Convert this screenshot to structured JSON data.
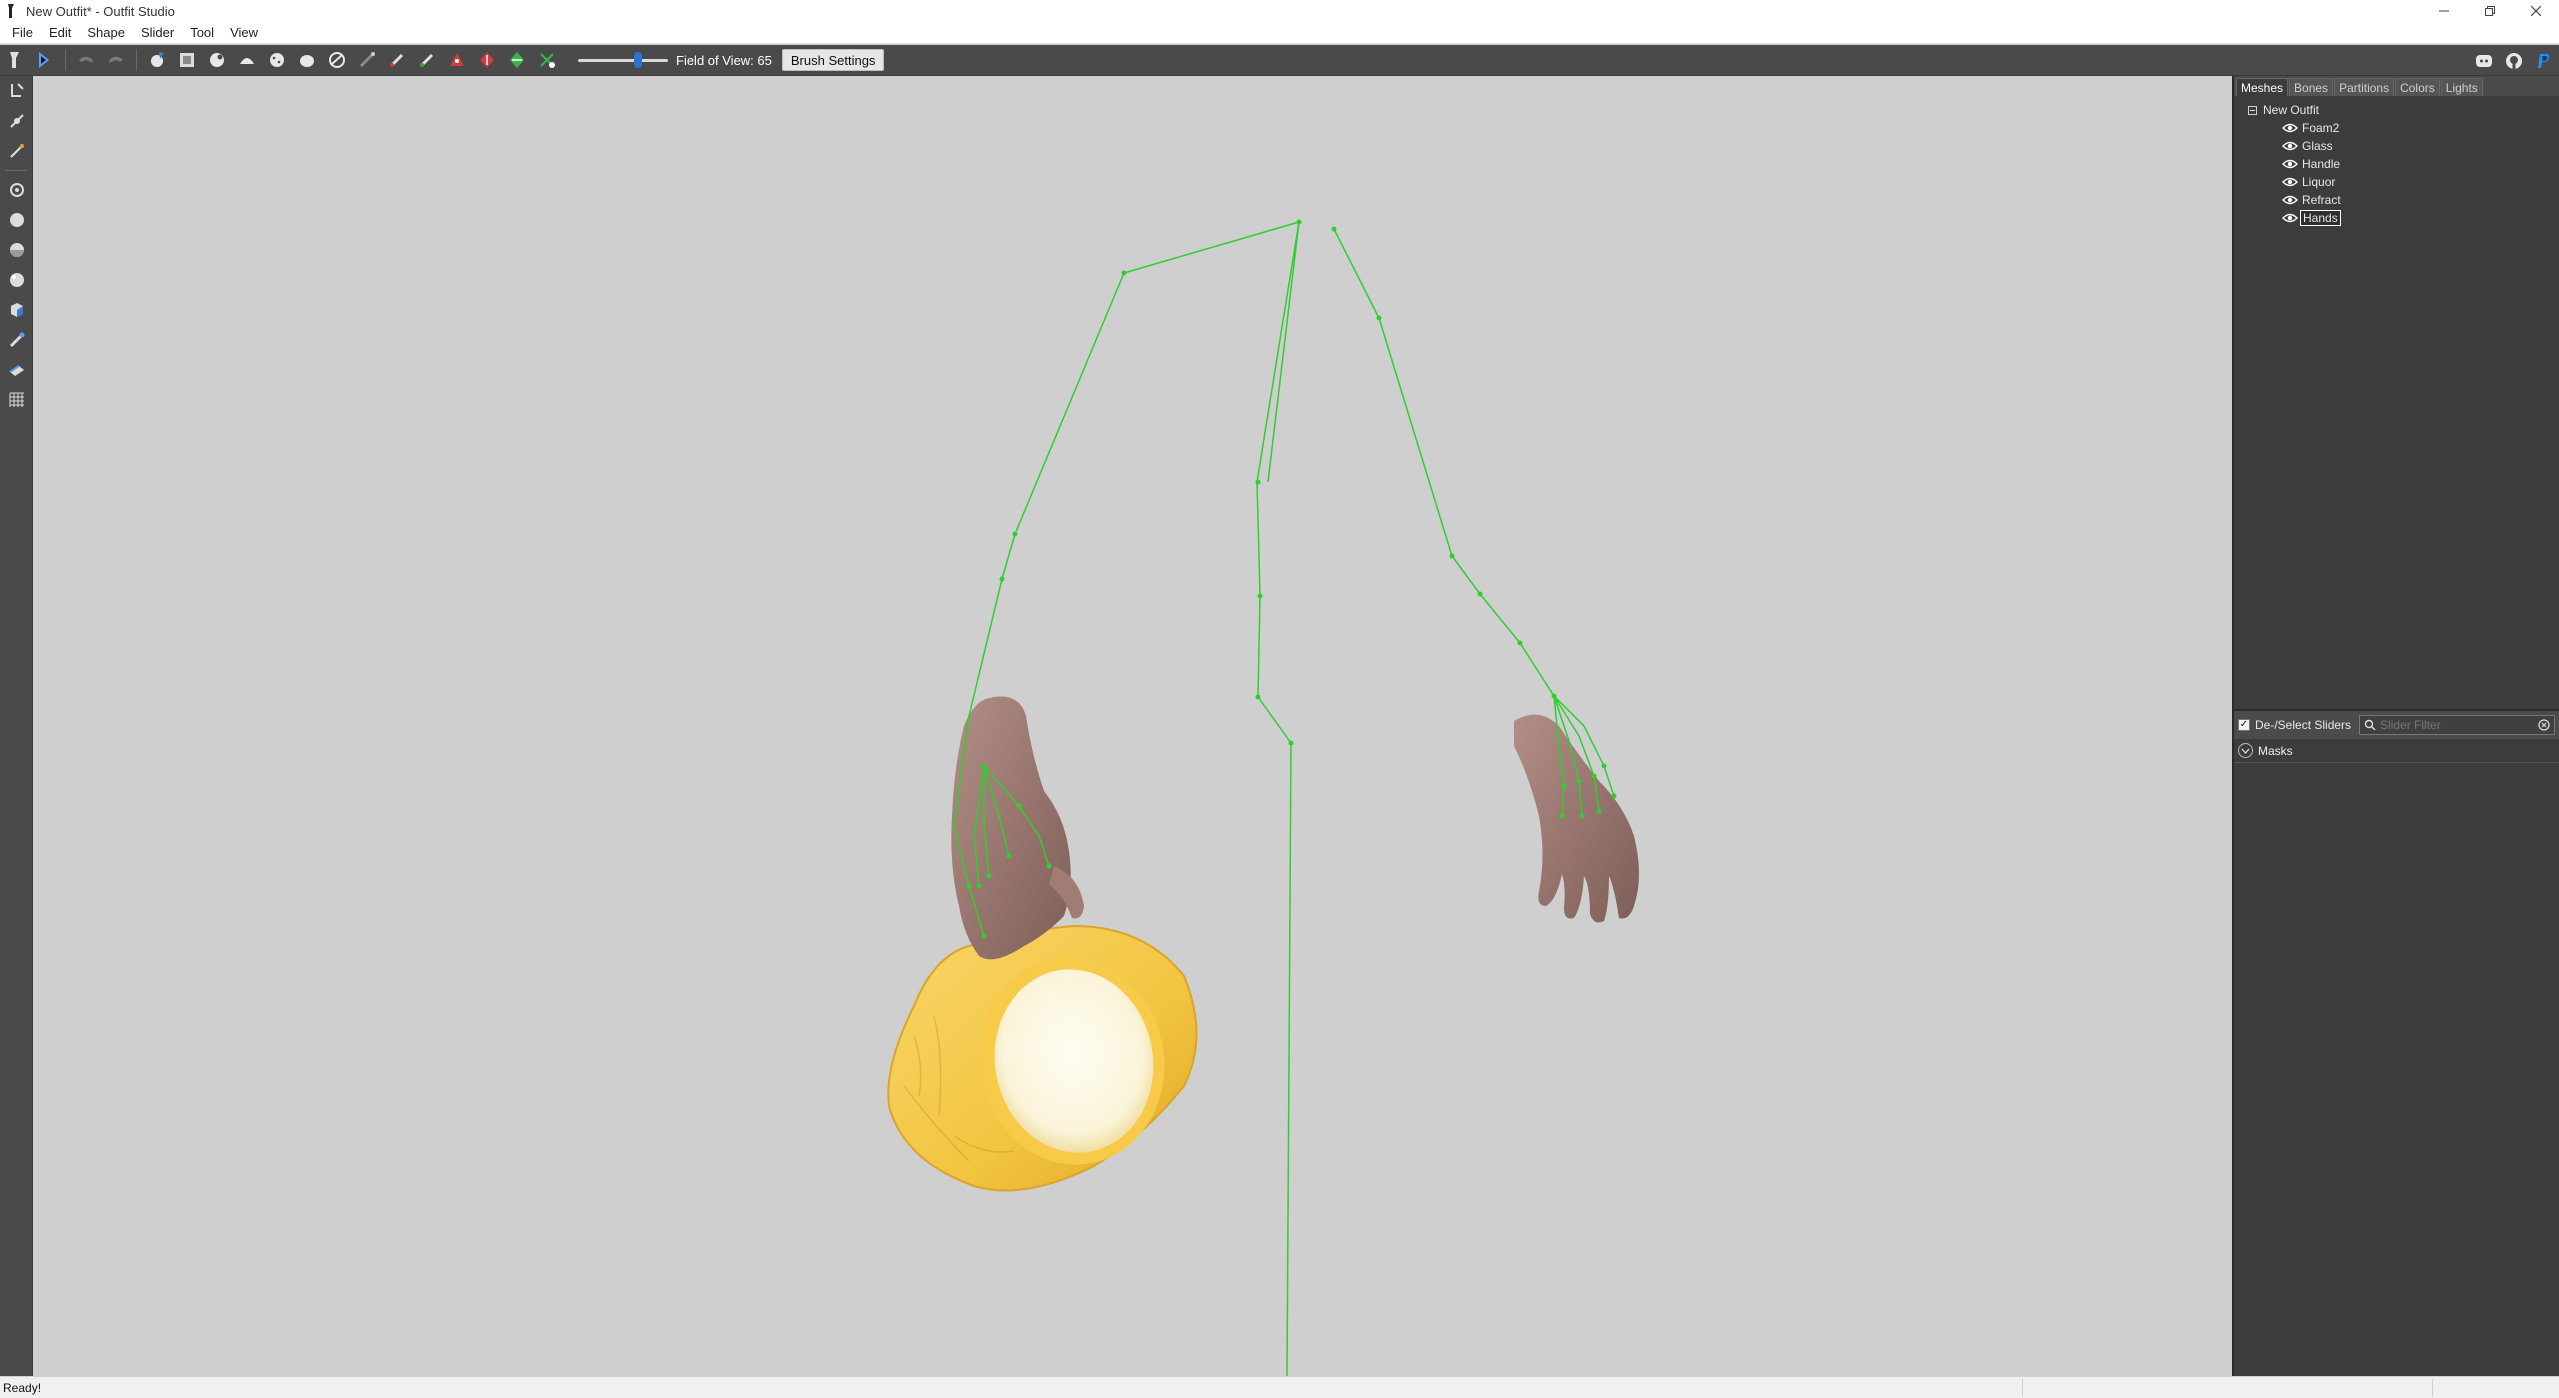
{
  "window": {
    "title": "New Outfit* - Outfit Studio",
    "controls": [
      "minimize",
      "restore",
      "close"
    ]
  },
  "menu": {
    "items": [
      "File",
      "Edit",
      "Shape",
      "Slider",
      "Tool",
      "View"
    ]
  },
  "toolbar": {
    "fov_label": "Field of View: 65",
    "fov_value": 65,
    "brush_settings_label": "Brush Settings",
    "buttons": [
      "select-icon",
      "transform-icon",
      "undo-icon",
      "redo-icon",
      "mask-brush-icon",
      "inflate-brush-icon",
      "deflate-brush-icon",
      "move-brush-icon",
      "smooth-brush-icon",
      "undiff-brush-icon",
      "weight-brush-icon",
      "weight-erase-icon",
      "color-brush-icon",
      "alpha-brush-icon",
      "collapse-vertex-icon",
      "flip-edge-icon",
      "split-edge-icon",
      "delete-vertex-icon"
    ],
    "right_icons": [
      "discord-icon",
      "github-icon",
      "paypal-icon"
    ]
  },
  "left_toolbar": {
    "buttons": [
      "select-icon",
      "transform-icon",
      "pivot-icon",
      "vertex-icon",
      "sphere-small-icon",
      "sphere-medium-icon",
      "sphere-large-icon",
      "shaded-icon",
      "bones-icon",
      "wireframe-icon",
      "grid-icon"
    ]
  },
  "right_panel": {
    "tabs": [
      "Meshes",
      "Bones",
      "Partitions",
      "Colors",
      "Lights"
    ],
    "active_tab": "Meshes",
    "tree": {
      "root": "New Outfit",
      "meshes": [
        "Foam2",
        "Glass",
        "Handle",
        "Liquor",
        "Refract",
        "Hands"
      ],
      "selected": "Hands"
    },
    "deselect_sliders_label": "De-/Select Sliders",
    "slider_filter_placeholder": "Slider Filter",
    "masks_label": "Masks"
  },
  "status": {
    "text": "Ready!"
  },
  "colors": {
    "skeleton": "#2fcf2f",
    "toolbar_bg": "#4a4a4a",
    "panel_bg": "#3c3c3c",
    "viewport_bg": "#cfcfcf",
    "mug": "#f2c440",
    "skin": "#9e7a72"
  }
}
